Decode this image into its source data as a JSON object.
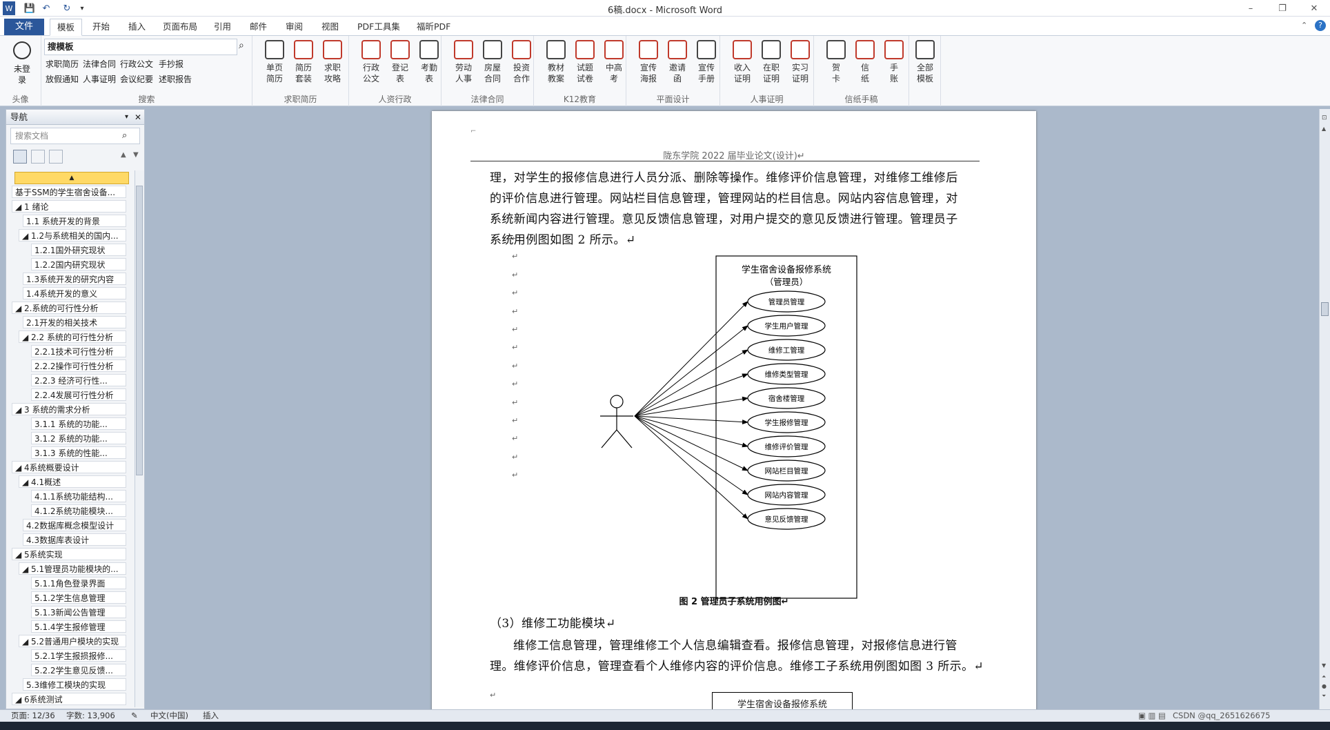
{
  "titlebar": {
    "title": "6稿.docx - Microsoft Word",
    "min": "–",
    "restore": "❐",
    "close": "✕"
  },
  "tabs": {
    "file": "文件",
    "items": [
      "模板",
      "开始",
      "插入",
      "页面布局",
      "引用",
      "邮件",
      "审阅",
      "视图",
      "PDF工具集",
      "福昕PDF"
    ]
  },
  "ribbon": {
    "avatar_label": "未登\n录",
    "group_avatar": "头像",
    "search_value": "搜模板",
    "links_row1": [
      "求职简历",
      "法律合同",
      "行政公文",
      "手抄报"
    ],
    "links_row2": [
      "放假通知",
      "人事证明",
      "会议纪要",
      "述职报告"
    ],
    "group_search": "搜索",
    "groups": [
      {
        "label": "求职简历",
        "buttons": [
          "单页\n简历",
          "简历\n套装",
          "求职\n攻略"
        ]
      },
      {
        "label": "人资行政",
        "buttons": [
          "行政\n公文",
          "登记\n表",
          "考勤\n表"
        ]
      },
      {
        "label": "法律合同",
        "buttons": [
          "劳动\n人事",
          "房屋\n合同",
          "投资\n合作"
        ]
      },
      {
        "label": "K12教育",
        "buttons": [
          "教材\n教案",
          "试题\n试卷",
          "中高\n考"
        ]
      },
      {
        "label": "平面设计",
        "buttons": [
          "宣传\n海报",
          "邀请\n函",
          "宣传\n手册"
        ]
      },
      {
        "label": "人事证明",
        "buttons": [
          "收入\n证明",
          "在职\n证明",
          "实习\n证明"
        ]
      },
      {
        "label": "信纸手稿",
        "buttons": [
          "贺\n卡",
          "信\n纸",
          "手\n账"
        ]
      }
    ],
    "all_templates": "全部\n模板"
  },
  "nav": {
    "title": "导航",
    "search_placeholder": "搜索文档",
    "items": [
      {
        "text": "基于SSM的学生宿舍设备...",
        "level": 0
      },
      {
        "text": "◢ 1 绪论",
        "level": 0
      },
      {
        "text": "1.1 系统开发的背景",
        "level": 2
      },
      {
        "text": "◢ 1.2与系统相关的国内...",
        "level": 1
      },
      {
        "text": "1.2.1国外研究现状",
        "level": 3
      },
      {
        "text": "1.2.2国内研究现状",
        "level": 3
      },
      {
        "text": "1.3系统开发的研究内容",
        "level": 2
      },
      {
        "text": "1.4系统开发的意义",
        "level": 2
      },
      {
        "text": "◢ 2.系统的可行性分析",
        "level": 0
      },
      {
        "text": "2.1开发的相关技术",
        "level": 2
      },
      {
        "text": "◢ 2.2 系统的可行性分析",
        "level": 1
      },
      {
        "text": "2.2.1技术可行性分析",
        "level": 3
      },
      {
        "text": "2.2.2操作可行性分析",
        "level": 3
      },
      {
        "text": "2.2.3 经济可行性...",
        "level": 3
      },
      {
        "text": "2.2.4发展可行性分析",
        "level": 3
      },
      {
        "text": "◢ 3 系统的需求分析",
        "level": 0
      },
      {
        "text": "3.1.1 系统的功能...",
        "level": 3
      },
      {
        "text": "3.1.2 系统的功能...",
        "level": 3
      },
      {
        "text": "3.1.3 系统的性能...",
        "level": 3
      },
      {
        "text": "◢ 4系统概要设计",
        "level": 0
      },
      {
        "text": "◢ 4.1概述",
        "level": 1
      },
      {
        "text": "4.1.1系统功能结构...",
        "level": 3
      },
      {
        "text": "4.1.2系统功能模块...",
        "level": 3
      },
      {
        "text": "4.2数据库概念模型设计",
        "level": 2
      },
      {
        "text": "4.3数据库表设计",
        "level": 2
      },
      {
        "text": "◢ 5系统实现",
        "level": 0
      },
      {
        "text": "◢ 5.1管理员功能模块的...",
        "level": 1
      },
      {
        "text": "5.1.1角色登录界面",
        "level": 3
      },
      {
        "text": "5.1.2学生信息管理",
        "level": 3
      },
      {
        "text": "5.1.3新闻公告管理",
        "level": 3
      },
      {
        "text": "5.1.4学生报修管理",
        "level": 3
      },
      {
        "text": "◢ 5.2普通用户模块的实现",
        "level": 1
      },
      {
        "text": "5.2.1学生报损报修...",
        "level": 3
      },
      {
        "text": "5.2.2学生意见反馈...",
        "level": 3
      },
      {
        "text": "5.3维修工模块的实现",
        "level": 2
      },
      {
        "text": "◢ 6系统测试",
        "level": 0
      }
    ]
  },
  "document": {
    "header": "陇东学院 2022 届毕业论文(设计)↵",
    "lines": [
      "理，对学生的报修信息进行人员分派、删除等操作。维修评价信息管理，对维修工维修后",
      "的评价信息进行管理。网站栏目信息管理，管理网站的栏目信息。网站内容信息管理，对",
      "系统新闻内容进行管理。意见反馈信息管理，对用户提交的意见反馈进行管理。管理员子",
      "系统用例图如图 2 所示。↵"
    ],
    "diagram": {
      "title1": "学生宿舍设备报修系统",
      "title2": "（管理员）",
      "use_cases": [
        "管理员管理",
        "学生用户管理",
        "维修工管理",
        "维修类型管理",
        "宿舍楼管理",
        "学生报修管理",
        "维修评价管理",
        "网站栏目管理",
        "网站内容管理",
        "意见反馈管理"
      ]
    },
    "caption": "图 2  管理员子系统用例图↵",
    "section": "（3）维修工功能模块↵",
    "lines2": [
      "维修工信息管理，管理维修工个人信息编辑查看。报修信息管理，对报修信息进行管",
      "理。维修评价信息，管理查看个人维修内容的评价信息。维修工子系统用例图如图 3 所示。↵"
    ],
    "diagram2_title": "学生宿舍设备报修系统",
    "para_mark": "↵"
  },
  "status": {
    "page": "页面: 12/36",
    "words": "字数: 13,906",
    "lang": "中文(中国)",
    "mode": "插入",
    "watermark": "CSDN @qq_2651626675"
  }
}
